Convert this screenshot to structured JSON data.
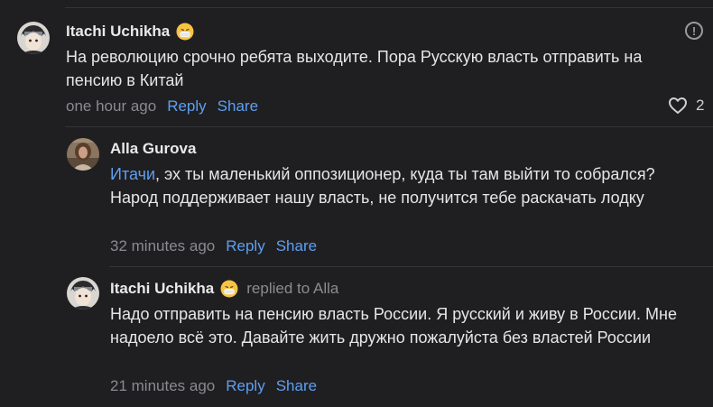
{
  "comments": [
    {
      "author": "Itachi Uchikha",
      "body": "На революцию срочно ребята выходите. Пора Русскую власть отправить на пенсию в Китай",
      "time": "one hour ago",
      "reply_label": "Reply",
      "share_label": "Share",
      "likes": "2",
      "avatar_icon": "anime-avatar-icon",
      "emoji_icon": "face-with-medical-mask-emoji"
    },
    {
      "author": "Alla Gurova",
      "mention": "Итачи",
      "body": ", эх ты маленький оппозиционер, куда ты там выйти то собрался? Народ поддерживает нашу власть, не получится тебе раскачать лодку",
      "time": "32 minutes ago",
      "reply_label": "Reply",
      "share_label": "Share",
      "avatar_icon": "woman-photo-avatar"
    },
    {
      "author": "Itachi Uchikha",
      "replied_to": "replied to Alla",
      "body": "Надо отправить на пенсию власть России. Я русский и живу в России. Мне надоело всё это. Давайте жить дружно пожалуйста без властей России",
      "time": "21 minutes ago",
      "reply_label": "Reply",
      "share_label": "Share",
      "avatar_icon": "anime-avatar-icon",
      "emoji_icon": "face-with-medical-mask-emoji"
    }
  ],
  "colors": {
    "background": "#1f1f21",
    "link": "#5f9ff0",
    "muted": "#8a8a8f",
    "text": "#e6e6e8"
  }
}
